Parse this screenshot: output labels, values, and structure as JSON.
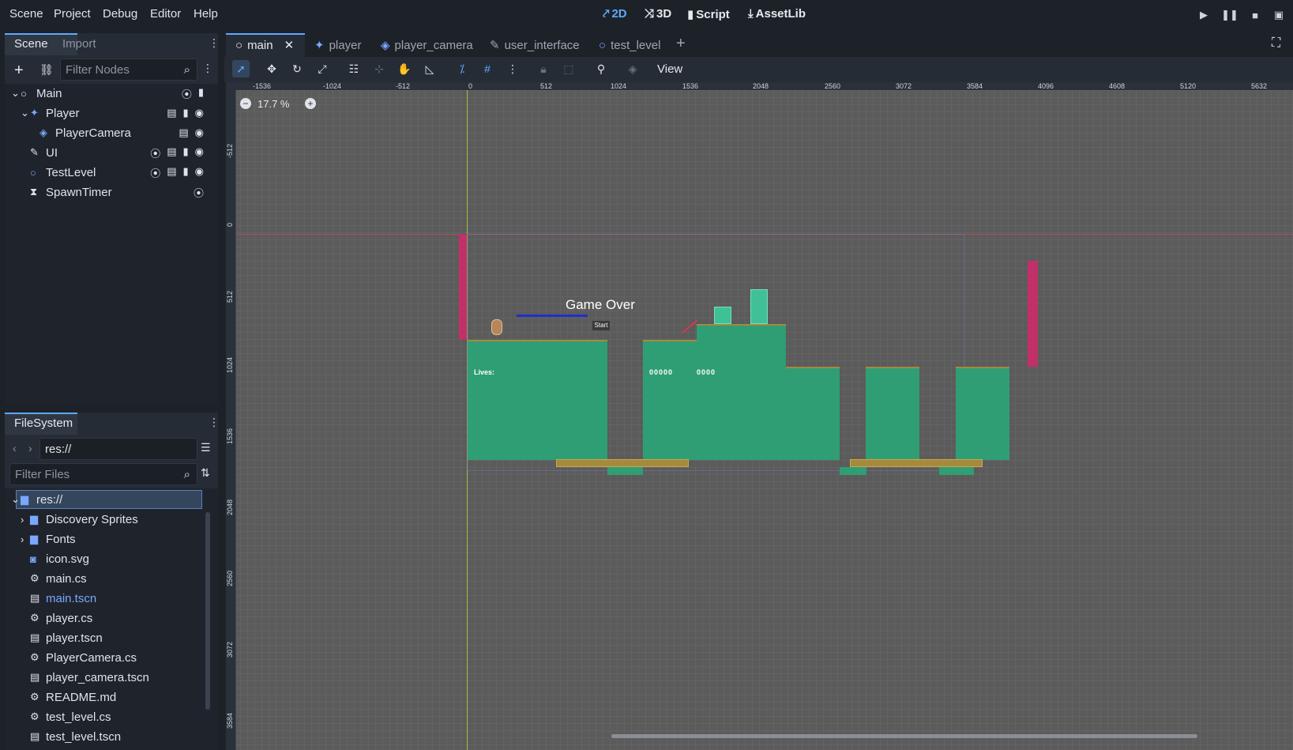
{
  "menu": {
    "items": [
      "Scene",
      "Project",
      "Debug",
      "Editor",
      "Help"
    ]
  },
  "workspaces": {
    "items": [
      "2D",
      "3D",
      "Script",
      "AssetLib"
    ],
    "active": "2D"
  },
  "left_dock": {
    "tabs": [
      "Scene",
      "Import"
    ],
    "filter_placeholder": "Filter Nodes",
    "nodes": [
      {
        "label": "Main",
        "icon": "node2d-icon"
      },
      {
        "label": "Player",
        "icon": "character-body-icon"
      },
      {
        "label": "PlayerCamera",
        "icon": "camera-icon"
      },
      {
        "label": "UI",
        "icon": "control-icon"
      },
      {
        "label": "TestLevel",
        "icon": "node2d-icon"
      },
      {
        "label": "SpawnTimer",
        "icon": "timer-icon"
      }
    ]
  },
  "filesystem": {
    "title": "FileSystem",
    "path": "res://",
    "filter_placeholder": "Filter Files",
    "items": [
      {
        "label": "res://",
        "icon": "folder-icon"
      },
      {
        "label": "Discovery Sprites",
        "icon": "folder-icon"
      },
      {
        "label": "Fonts",
        "icon": "folder-icon"
      },
      {
        "label": "icon.svg",
        "icon": "image-icon"
      },
      {
        "label": "main.cs",
        "icon": "script-icon"
      },
      {
        "label": "main.tscn",
        "icon": "scene-icon"
      },
      {
        "label": "player.cs",
        "icon": "script-icon"
      },
      {
        "label": "player.tscn",
        "icon": "scene-icon"
      },
      {
        "label": "PlayerCamera.cs",
        "icon": "script-icon"
      },
      {
        "label": "player_camera.tscn",
        "icon": "scene-icon"
      },
      {
        "label": "README.md",
        "icon": "script-icon"
      },
      {
        "label": "test_level.cs",
        "icon": "script-icon"
      },
      {
        "label": "test_level.tscn",
        "icon": "scene-icon"
      }
    ]
  },
  "scene_tabs": [
    "main",
    "player",
    "player_camera",
    "user_interface",
    "test_level"
  ],
  "toolbar": {
    "view_label": "View"
  },
  "viewport": {
    "zoom": "17.7 %",
    "ruler_ticks": [
      "-1536",
      "-1024",
      "-512",
      "0",
      "512",
      "1024",
      "1536",
      "2048",
      "2560",
      "3072",
      "3584",
      "4096",
      "4608",
      "5120",
      "5632"
    ],
    "vruler_ticks": [
      "-512",
      "0",
      "512",
      "1024",
      "1536",
      "2048",
      "2560",
      "3072",
      "3584"
    ],
    "game_over_text": "Game Over",
    "start_text": "Start",
    "lives_text": "Lives:",
    "score_text": "00000",
    "hiscore_text": "0000"
  },
  "colors": {
    "accent": "#5fa8ff",
    "ground": "#2f9e74",
    "platform": "#b58a3b",
    "wall": "#c2306a"
  }
}
